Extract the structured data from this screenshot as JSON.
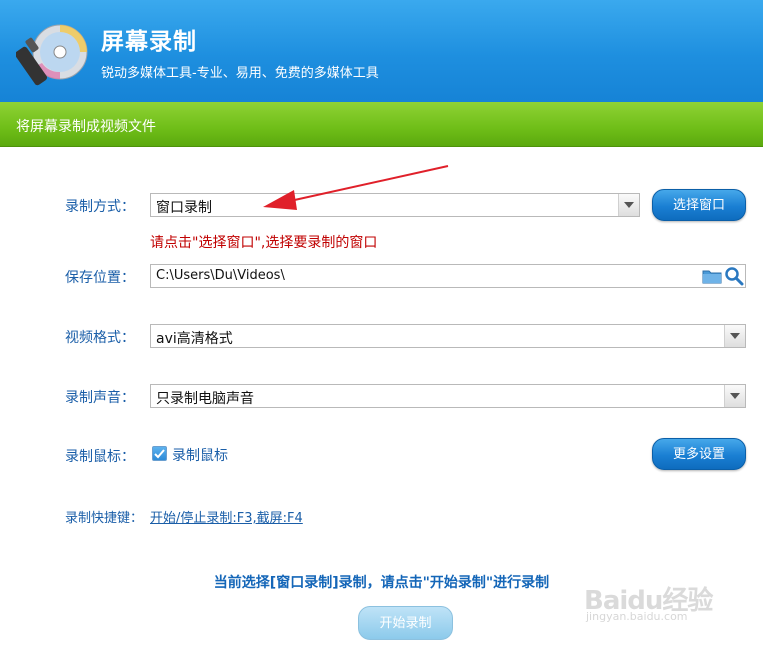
{
  "header": {
    "title": "屏幕录制",
    "subtitle": "锐动多媒体工具-专业、易用、免费的多媒体工具"
  },
  "subheader": {
    "text": "将屏幕录制成视频文件"
  },
  "record_mode": {
    "label": "录制方式：",
    "value": "窗口录制",
    "button": "选择窗口",
    "hint": "请点击\"选择窗口\",选择要录制的窗口"
  },
  "save_location": {
    "label": "保存位置：",
    "value": "C:\\Users\\Du\\Videos\\",
    "folder_icon": "folder-icon",
    "search_icon": "search-icon"
  },
  "video_format": {
    "label": "视频格式：",
    "value": "avi高清格式"
  },
  "record_audio": {
    "label": "录制声音：",
    "value": "只录制电脑声音"
  },
  "record_mouse": {
    "label": "录制鼠标：",
    "checkbox_label": "录制鼠标",
    "checked": true,
    "more_button": "更多设置"
  },
  "shortcut": {
    "label": "录制快捷键：",
    "link": "开始/停止录制:F3,截屏:F4"
  },
  "status": "当前选择[窗口录制]录制，请点击\"开始录制\"进行录制",
  "start_button": "开始录制",
  "watermark": {
    "logo": "Baidu经验",
    "sub": "jingyan.baidu.com"
  },
  "colors": {
    "header_blue": "#1e8fdf",
    "subheader_green": "#6fbe18",
    "label_blue": "#1a5ea8",
    "hint_red": "#c00000",
    "annotation_arrow": "#e0202a"
  }
}
